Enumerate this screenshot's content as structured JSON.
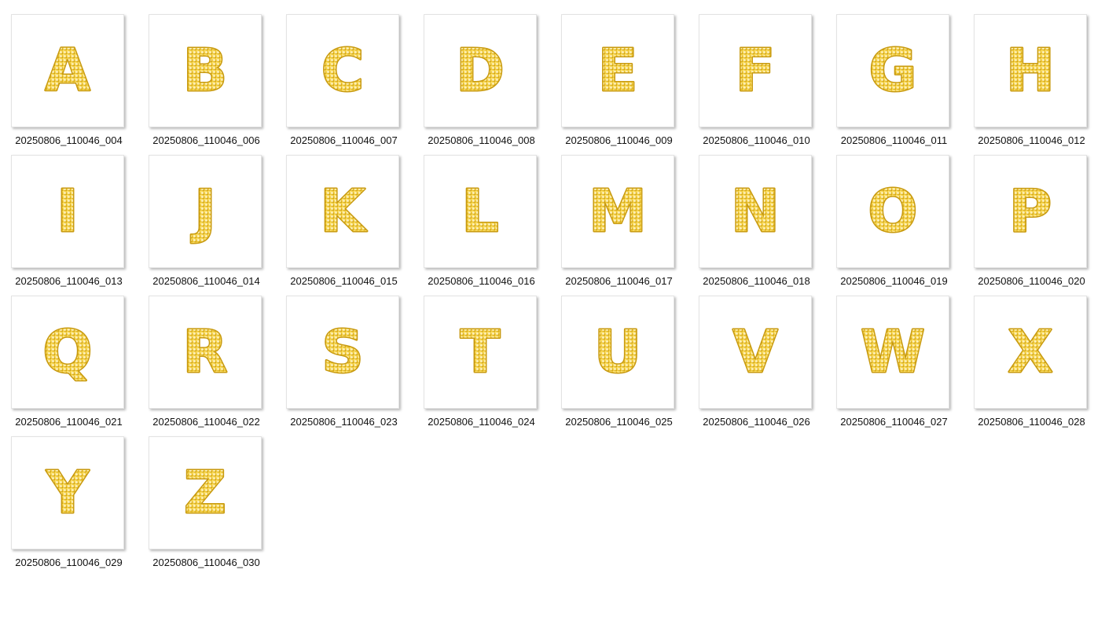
{
  "colors": {
    "gold_light": "#ffe98a",
    "gold_mid": "#f2cc3a",
    "gold_dark": "#c89a10",
    "stone": "#fff8d8"
  },
  "files": [
    {
      "name": "20250806_110046_004",
      "letter": "A"
    },
    {
      "name": "20250806_110046_006",
      "letter": "B"
    },
    {
      "name": "20250806_110046_007",
      "letter": "C"
    },
    {
      "name": "20250806_110046_008",
      "letter": "D"
    },
    {
      "name": "20250806_110046_009",
      "letter": "E"
    },
    {
      "name": "20250806_110046_010",
      "letter": "F"
    },
    {
      "name": "20250806_110046_011",
      "letter": "G"
    },
    {
      "name": "20250806_110046_012",
      "letter": "H"
    },
    {
      "name": "20250806_110046_013",
      "letter": "I"
    },
    {
      "name": "20250806_110046_014",
      "letter": "J"
    },
    {
      "name": "20250806_110046_015",
      "letter": "K"
    },
    {
      "name": "20250806_110046_016",
      "letter": "L"
    },
    {
      "name": "20250806_110046_017",
      "letter": "M"
    },
    {
      "name": "20250806_110046_018",
      "letter": "N"
    },
    {
      "name": "20250806_110046_019",
      "letter": "O"
    },
    {
      "name": "20250806_110046_020",
      "letter": "P"
    },
    {
      "name": "20250806_110046_021",
      "letter": "Q"
    },
    {
      "name": "20250806_110046_022",
      "letter": "R"
    },
    {
      "name": "20250806_110046_023",
      "letter": "S"
    },
    {
      "name": "20250806_110046_024",
      "letter": "T"
    },
    {
      "name": "20250806_110046_025",
      "letter": "U"
    },
    {
      "name": "20250806_110046_026",
      "letter": "V"
    },
    {
      "name": "20250806_110046_027",
      "letter": "W"
    },
    {
      "name": "20250806_110046_028",
      "letter": "X"
    },
    {
      "name": "20250806_110046_029",
      "letter": "Y"
    },
    {
      "name": "20250806_110046_030",
      "letter": "Z"
    }
  ]
}
